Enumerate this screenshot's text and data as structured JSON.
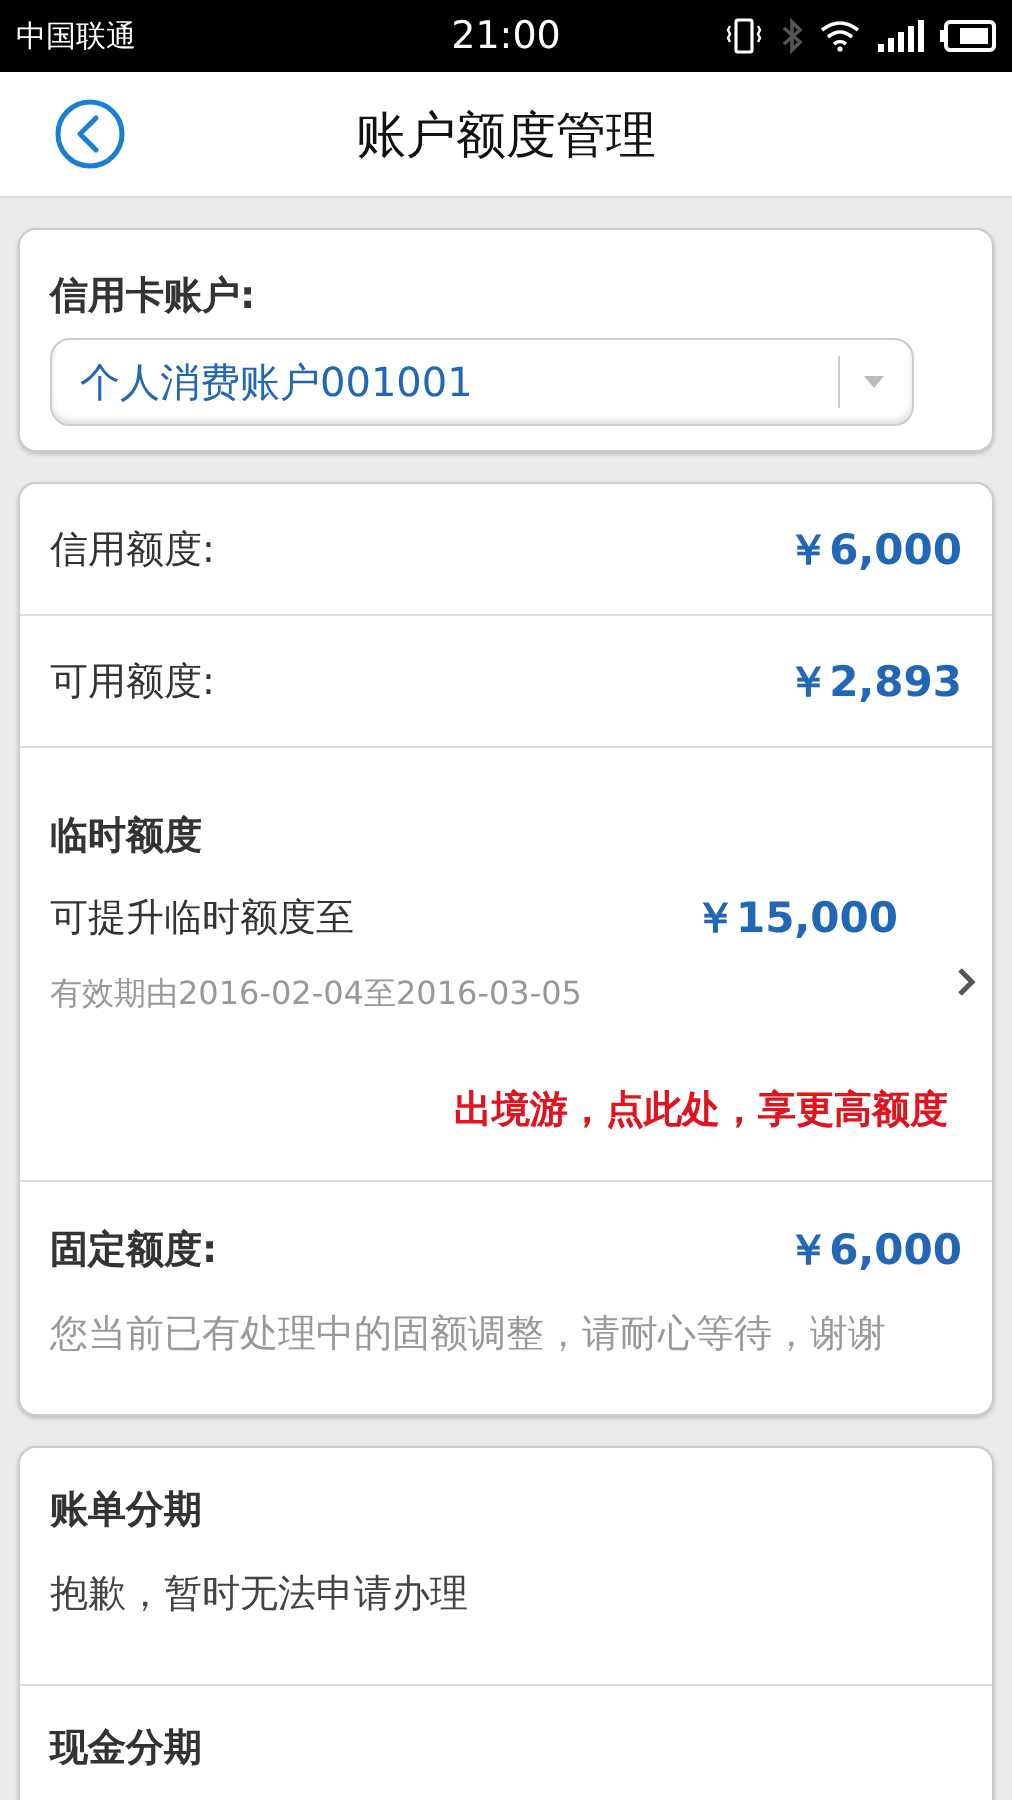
{
  "status_bar": {
    "carrier": "中国联通",
    "time": "21:00"
  },
  "header": {
    "title": "账户额度管理"
  },
  "account": {
    "label": "信用卡账户:",
    "value": "个人消费账户001001"
  },
  "limits": [
    {
      "kind": "simple",
      "label": "信用额度:",
      "amount": "￥6,000"
    },
    {
      "kind": "simple",
      "label": "可用额度:",
      "amount": "￥2,893"
    },
    {
      "kind": "temporary",
      "title": "临时额度",
      "description": "可提升临时额度至",
      "amount": "￥15,000",
      "validity": "有效期由2016-02-04至2016-03-05",
      "promo": "出境游，点此处，享更高额度"
    },
    {
      "kind": "fixed",
      "label": "固定额度:",
      "amount": "￥6,000",
      "note": "您当前已有处理中的固额调整，请耐心等待，谢谢"
    }
  ],
  "installments": [
    {
      "title": "账单分期",
      "note": "抱歉，暂时无法申请办理"
    },
    {
      "title": "现金分期"
    }
  ]
}
